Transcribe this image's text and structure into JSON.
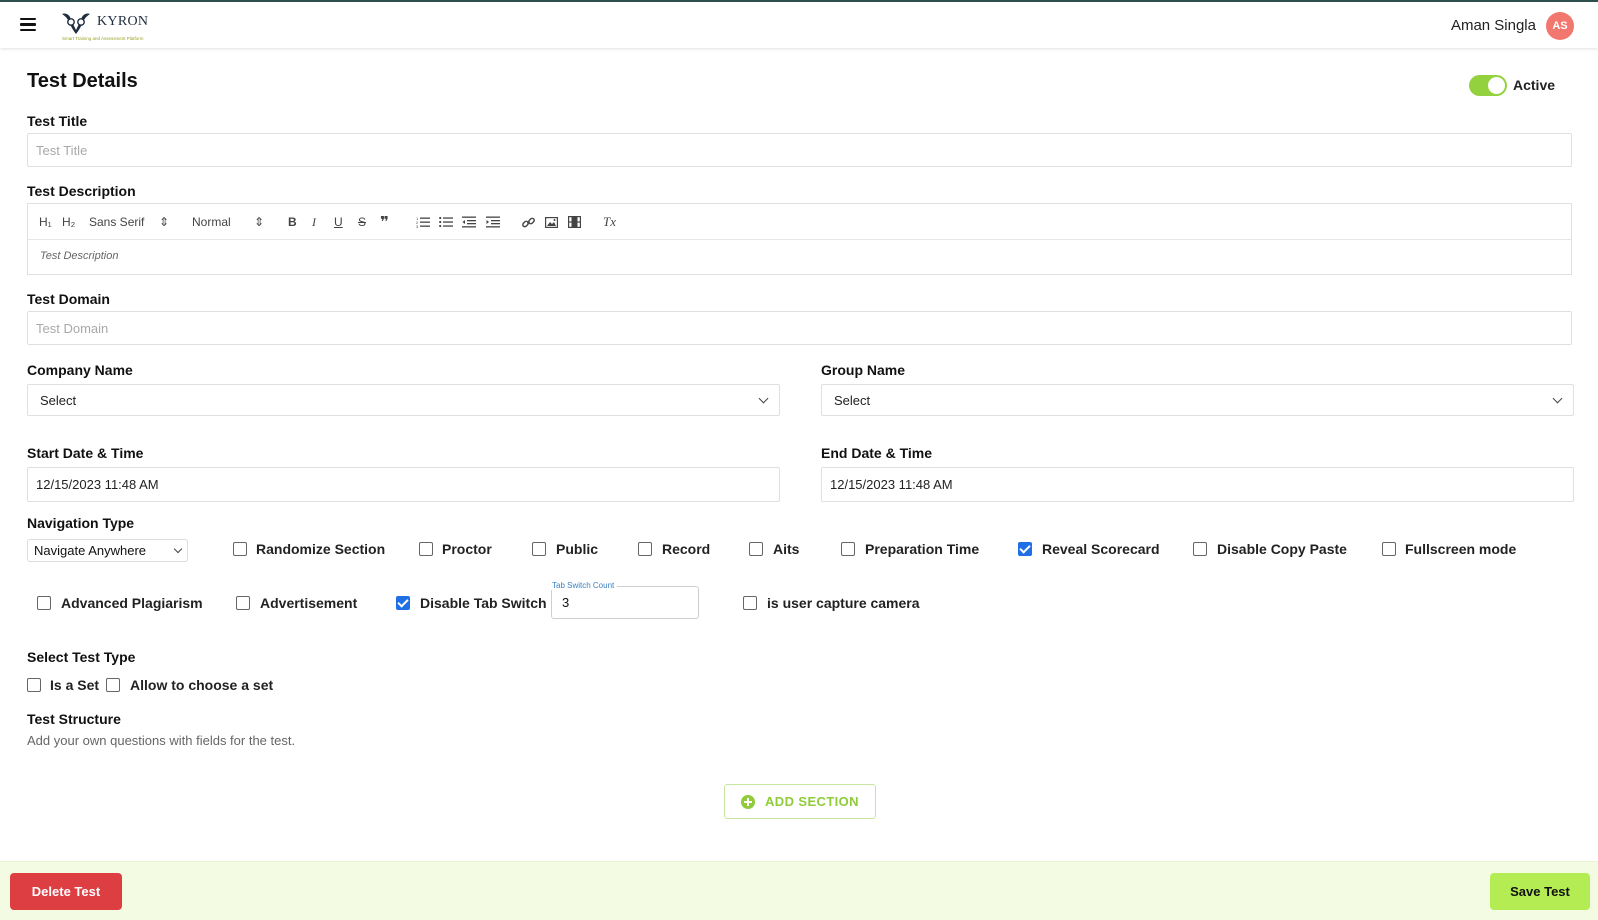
{
  "header": {
    "logo_text": "KYRON",
    "logo_tagline": "Smart Training and Assessment Platform",
    "user_name": "Aman Singla",
    "avatar_initials": "AS",
    "accent_color": "#93d13e"
  },
  "page": {
    "title": "Test Details",
    "status_label": "Active",
    "status_active": true
  },
  "fields": {
    "test_title": {
      "label": "Test Title",
      "placeholder": "Test Title",
      "value": ""
    },
    "test_description": {
      "label": "Test Description",
      "placeholder": "Test Description",
      "toolbar": {
        "h1": "H₁",
        "h2": "H₂",
        "font": "Sans Serif",
        "size": "Normal",
        "bold": "B",
        "italic": "I",
        "underline": "U",
        "strike": "S",
        "quote": "❞",
        "clean": "Tx"
      }
    },
    "test_domain": {
      "label": "Test Domain",
      "placeholder": "Test Domain",
      "value": ""
    },
    "company_name": {
      "label": "Company Name",
      "value": "Select"
    },
    "group_name": {
      "label": "Group Name",
      "value": "Select"
    },
    "start_datetime": {
      "label": "Start Date & Time",
      "value": "12/15/2023 11:48 AM"
    },
    "end_datetime": {
      "label": "End Date & Time",
      "value": "12/15/2023 11:48 AM"
    },
    "navigation_type": {
      "label": "Navigation Type",
      "value": "Navigate Anywhere"
    }
  },
  "options_row1": [
    {
      "label": "Randomize Section",
      "checked": false
    },
    {
      "label": "Proctor",
      "checked": false
    },
    {
      "label": "Public",
      "checked": false
    },
    {
      "label": "Record",
      "checked": false
    },
    {
      "label": "Aits",
      "checked": false
    },
    {
      "label": "Preparation Time",
      "checked": false
    },
    {
      "label": "Reveal Scorecard",
      "checked": true
    },
    {
      "label": "Disable Copy Paste",
      "checked": false
    },
    {
      "label": "Fullscreen mode",
      "checked": false
    }
  ],
  "options_row2": [
    {
      "label": "Advanced Plagiarism",
      "checked": false
    },
    {
      "label": "Advertisement",
      "checked": false
    },
    {
      "label": "Disable Tab Switch",
      "checked": true
    },
    {
      "label": "is user capture camera",
      "checked": false
    }
  ],
  "tab_switch_count": {
    "label": "Tab Switch Count",
    "value": "3"
  },
  "test_type": {
    "label": "Select Test Type",
    "options": [
      {
        "label": "Is a Set",
        "checked": false
      },
      {
        "label": "Allow to choose a set",
        "checked": false
      }
    ]
  },
  "test_structure": {
    "label": "Test Structure",
    "description": "Add your own questions with fields for the test.",
    "add_section_label": "ADD SECTION"
  },
  "footer": {
    "delete_label": "Delete Test",
    "save_label": "Save Test",
    "delete_color": "#dc3e42",
    "save_color": "#b4ed53"
  }
}
